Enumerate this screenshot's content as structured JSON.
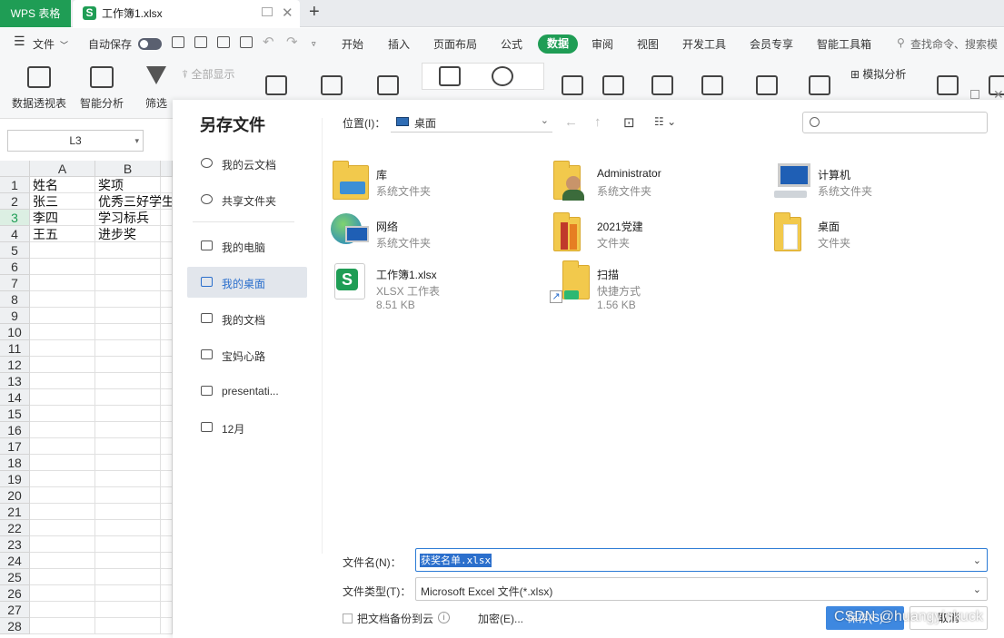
{
  "app": {
    "name": "WPS 表格",
    "doc_tab": "工作簿1.xlsx"
  },
  "menubar": {
    "file": "文件",
    "autosave": "自动保存",
    "tabs": [
      "开始",
      "插入",
      "页面布局",
      "公式",
      "数据",
      "审阅",
      "视图",
      "开发工具",
      "会员专享",
      "智能工具箱"
    ],
    "search": "查找命令、搜索模"
  },
  "ribbon": {
    "pivot": "数据透视表",
    "smart_analysis": "智能分析",
    "filter": "筛选",
    "show_all": "全部显示",
    "what_if": "模拟分析"
  },
  "sheet": {
    "namebox": "L3",
    "columns": [
      "A",
      "B"
    ],
    "rows": [
      "1",
      "2",
      "3",
      "4",
      "5",
      "6",
      "7",
      "8",
      "9",
      "10",
      "11",
      "12",
      "13",
      "14",
      "15",
      "16",
      "17",
      "18",
      "19",
      "20",
      "21",
      "22",
      "23",
      "24",
      "25",
      "26",
      "27",
      "28"
    ],
    "cells": [
      [
        "姓名",
        "奖项"
      ],
      [
        "张三",
        "优秀三好学生"
      ],
      [
        "李四",
        "学习标兵"
      ],
      [
        "王五",
        "进步奖"
      ]
    ]
  },
  "dialog": {
    "title": "另存文件",
    "sidebar": [
      "我的云文档",
      "共享文件夹",
      "我的电脑",
      "我的桌面",
      "我的文档",
      "宝妈心路",
      "presentati...",
      "12月"
    ],
    "location_label": "位置(I)：",
    "location_value": "桌面",
    "files": [
      {
        "name": "库",
        "desc": "系统文件夹",
        "size": "",
        "icon": "library-icon"
      },
      {
        "name": "Administrator",
        "desc": "系统文件夹",
        "size": "",
        "icon": "user-folder-icon"
      },
      {
        "name": "计算机",
        "desc": "系统文件夹",
        "size": "",
        "icon": "computer-icon"
      },
      {
        "name": "网络",
        "desc": "系统文件夹",
        "size": "",
        "icon": "network-icon"
      },
      {
        "name": "2021党建",
        "desc": "文件夹",
        "size": "",
        "icon": "folder-icon"
      },
      {
        "name": "桌面",
        "desc": "文件夹",
        "size": "",
        "icon": "folder-icon"
      },
      {
        "name": "工作簿1.xlsx",
        "desc": "XLSX 工作表",
        "size": "8.51 KB",
        "icon": "wps-sheet-icon"
      },
      {
        "name": "扫描",
        "desc": "快捷方式",
        "size": "1.56 KB",
        "icon": "shortcut-folder-icon"
      }
    ],
    "filename_label": "文件名(N)：",
    "filename_value": "获奖名单.xlsx",
    "filetype_label": "文件类型(T)：",
    "filetype_value": "Microsoft Excel 文件(*.xlsx)",
    "backup_label": "把文档备份到云",
    "encrypt": "加密(E)...",
    "save": "保存(S)",
    "cancel": "取消"
  },
  "watermark": "CSDN @huangyinkuck",
  "colors": {
    "brand": "#1f9d55",
    "primary": "#3e88e0",
    "active_nav": "#2b6fcc"
  }
}
